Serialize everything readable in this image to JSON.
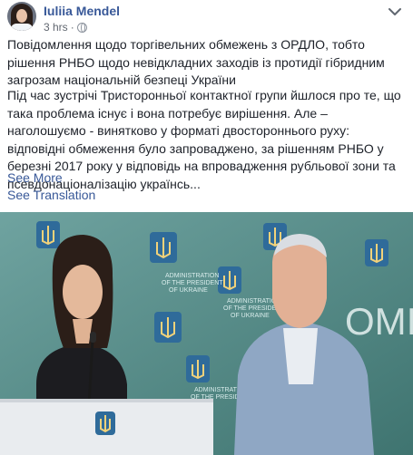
{
  "post": {
    "author": "Iuliia Mendel",
    "time": "3 hrs",
    "time_separator": "·",
    "icons": {
      "privacy": "globe-icon",
      "options": "chevron-down-icon"
    },
    "paragraph1": "Повідомлення щодо торгівельних обмежень з ОРДЛО, тобто рішення РНБО щодо невідкладних заходів із протидії гібридним загрозам національній безпеці України",
    "paragraph2": "Під час зустрічі Тристоронньої контактної групи йшлося про те, що така проблема існує і вона потребує вирішення. Але – наголошуємо - винятково у форматі двостороннього руху: відповідні обмеження було запроваджено, за рішенням РНБО у березні 2017 року у відповідь на впровадження рубльової зони та псевдонаціоналізацію українсь...",
    "see_more": "See More",
    "see_translation": "See Translation"
  },
  "photo": {
    "backdrop_text": "ADMINISTRATION OF THE PRESIDENT OF UKRAINE",
    "backdrop_text_2": "ADMINISTRATION",
    "backdrop_text_3": "OF THE PRESIDENT",
    "backdrop_text_4": "OF UKRAINE",
    "large_backdrop_text": "ОМІ",
    "colors": {
      "backdrop": "#5a8e8a",
      "emblem": "#2f6b9a",
      "podium": "#e9ecef"
    }
  }
}
